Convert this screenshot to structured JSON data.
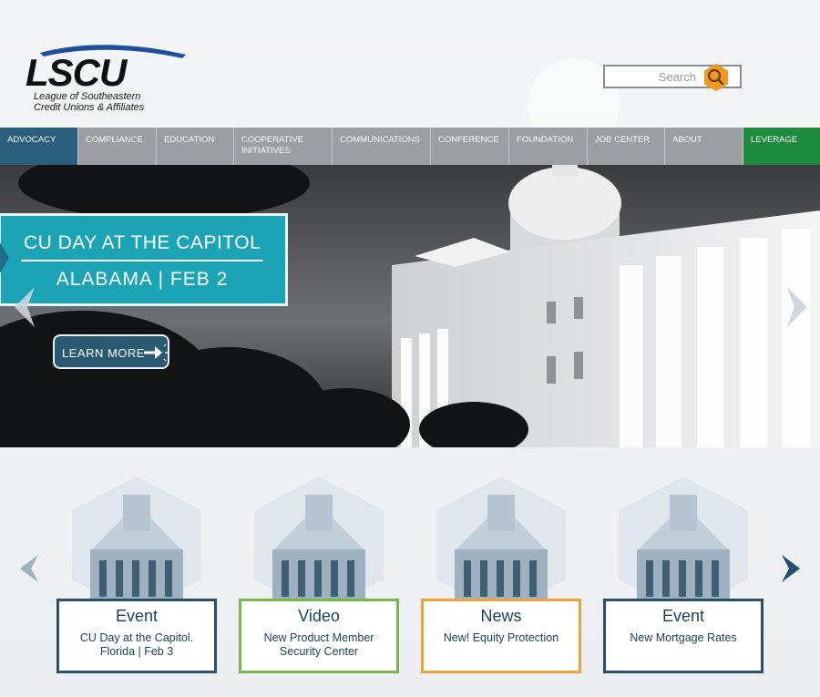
{
  "brand": {
    "logo_text": "LSCU",
    "tagline_line1": "League of Southeastern",
    "tagline_line2": "Credit Unions & Affiliates"
  },
  "search": {
    "placeholder": "Search",
    "icon": "search-icon",
    "accent_color": "#f29a1d"
  },
  "nav": {
    "items": [
      {
        "label": "ADVOCACY"
      },
      {
        "label": "COMPLIANCE"
      },
      {
        "label": "EDUCATION"
      },
      {
        "label": "COOPERATIVE INITIATIVES"
      },
      {
        "label": "COMMUNICATIONS"
      },
      {
        "label": "CONFERENCE"
      },
      {
        "label": "FOUNDATION"
      },
      {
        "label": "JOB CENTER"
      },
      {
        "label": "ABOUT"
      },
      {
        "label": "LEVERAGE"
      }
    ],
    "active_color": "#2a5f7c",
    "leverage_color": "#1d8a3e"
  },
  "hero": {
    "title_line1": "CU DAY AT THE CAPITOL",
    "title_line2": "ALABAMA | FEB 2",
    "cta_label": "LEARN MORE",
    "banner_color": "#1aa4b5"
  },
  "cards": [
    {
      "kind": "Event",
      "desc": "CU Day at the Capitol. Florida | Feb 3"
    },
    {
      "kind": "Video",
      "desc": "New Product Member Security Center"
    },
    {
      "kind": "News",
      "desc": "New! Equity Protection"
    },
    {
      "kind": "Event",
      "desc": "New Mortgage Rates"
    }
  ]
}
